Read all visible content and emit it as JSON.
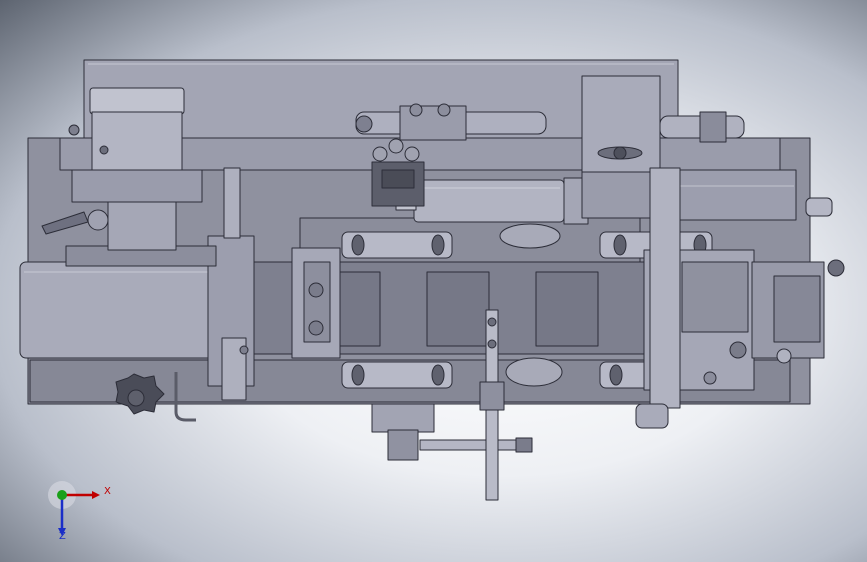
{
  "view": {
    "background_center": "#ffffff",
    "background_edge": "#5d6470",
    "part_fill": "#9ea0b0",
    "part_dark": "#7a7c8c",
    "part_light": "#b8bac8",
    "edge_color": "#2c2d38"
  },
  "triad": {
    "x_label": "X",
    "z_label": "Z",
    "x_color": "#c00000",
    "y_color": "#1aa01a",
    "z_color": "#1a2ec8"
  }
}
